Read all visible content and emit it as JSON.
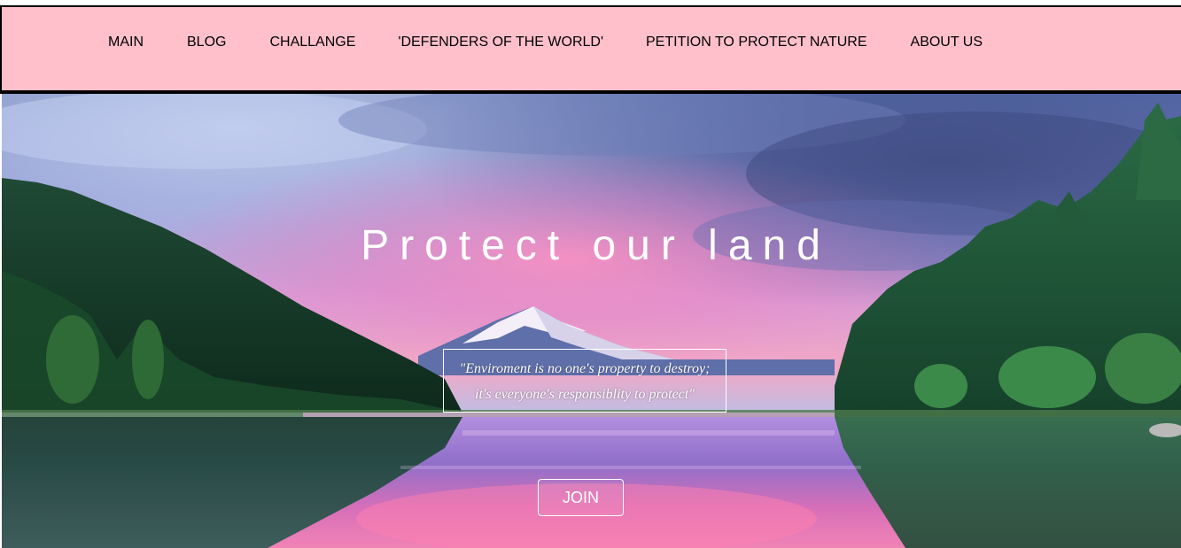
{
  "nav": {
    "items": [
      {
        "label": "MAIN"
      },
      {
        "label": "BLOG"
      },
      {
        "label": "CHALLANGE"
      },
      {
        "label": "'DEFENDERS OF THE WORLD'"
      },
      {
        "label": "PETITION TO PROTECT NATURE"
      },
      {
        "label": "ABOUT US"
      }
    ]
  },
  "hero": {
    "title": "Protect our land",
    "quote_line1": "\"Enviroment is no one's property to destroy;",
    "quote_line2": "it's everyone's responsiblity to protect\"",
    "join_label": "JOIN"
  },
  "colors": {
    "nav_background": "#ffc0cb",
    "nav_border": "#000000",
    "hero_text": "#ffffff"
  }
}
